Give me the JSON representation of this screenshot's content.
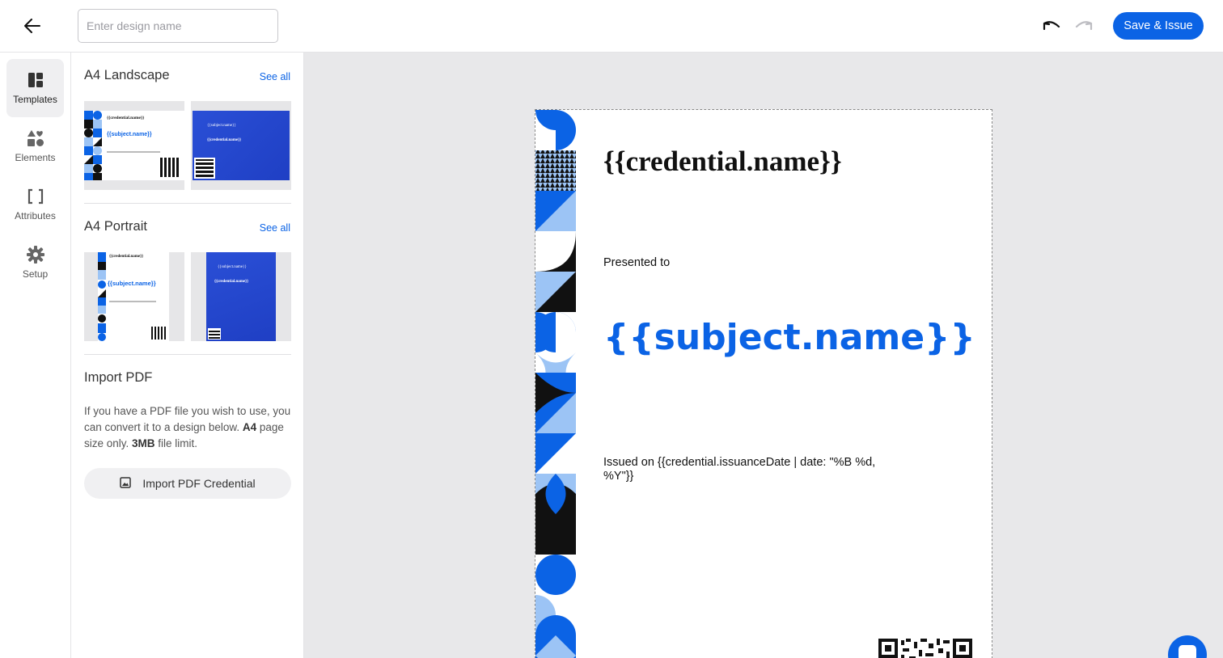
{
  "header": {
    "design_name_placeholder": "Enter design name",
    "design_name_value": "",
    "save_label": "Save & Issue"
  },
  "nav": {
    "items": [
      {
        "label": "Templates",
        "icon": "layout-icon",
        "active": true
      },
      {
        "label": "Elements",
        "icon": "shapes-icon",
        "active": false
      },
      {
        "label": "Attributes",
        "icon": "brackets-icon",
        "active": false
      },
      {
        "label": "Setup",
        "icon": "gear-icon",
        "active": false
      }
    ]
  },
  "panel": {
    "landscape": {
      "title": "A4 Landscape",
      "see_all": "See all",
      "thumbs": [
        {
          "heading": "{{credential.name}}",
          "subject": "{{subject.name}}",
          "style": "white"
        },
        {
          "heading": "{{subject.name}}",
          "subject": "{{credential.name}}",
          "style": "blue"
        }
      ]
    },
    "portrait": {
      "title": "A4 Portrait",
      "see_all": "See all",
      "thumbs": [
        {
          "heading": "{{credential.name}}",
          "subject": "{{subject.name}}",
          "style": "white"
        },
        {
          "heading": "{{subject.name}}",
          "subject": "{{credential.name}}",
          "style": "blue"
        }
      ]
    },
    "import": {
      "title": "Import PDF",
      "text_1": "If you have a PDF file you wish to use, you can convert it to a design below. ",
      "bold_1": "A4",
      "text_2": " page size only. ",
      "bold_2": "3MB",
      "text_3": " file limit.",
      "button_label": "Import PDF Credential"
    }
  },
  "certificate": {
    "credential_name": "{{credential.name}}",
    "presented_to": "Presented to",
    "subject_name": "{{subject.name}}",
    "issued_on": "Issued on {{credential.issuanceDate | date: \"%B %d, %Y\"}}"
  },
  "colors": {
    "accent": "#0b63e5",
    "light_blue": "#9cc4f5",
    "canvas_bg": "#e8e8ea"
  }
}
